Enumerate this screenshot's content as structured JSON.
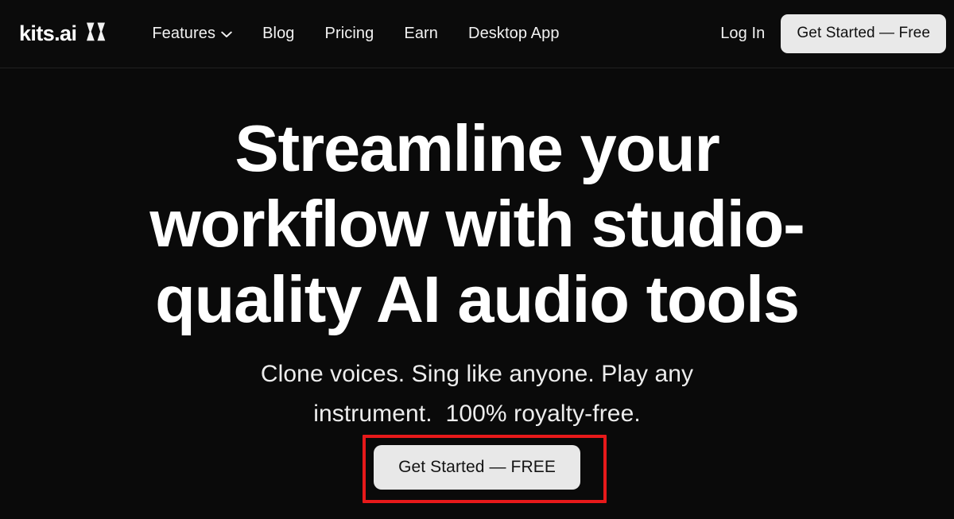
{
  "site": {
    "brand_name": "kits.ai",
    "brand_mark_icon": "double-chevron-k-mark",
    "background_color": "#0a0a0a"
  },
  "header": {
    "nav_items": [
      {
        "label": "Features",
        "has_dropdown": true,
        "dropdown_icon": "chevron-down-icon"
      },
      {
        "label": "Blog",
        "has_dropdown": false
      },
      {
        "label": "Pricing",
        "has_dropdown": false
      },
      {
        "label": "Earn",
        "has_dropdown": false
      },
      {
        "label": "Desktop App",
        "has_dropdown": false
      }
    ],
    "login_label": "Log In",
    "cta_label": "Get Started — Free",
    "cta_background_color": "#e9e9e9",
    "cta_text_color": "#101010"
  },
  "hero": {
    "headline_lines": [
      "Streamline your",
      "workflow with studio-",
      "quality AI audio tools"
    ],
    "subhead_lines": [
      "Clone voices. Sing like anyone. Play any",
      "instrument.  100% royalty-free."
    ],
    "cta_label": "Get Started — FREE",
    "cta_background_color": "#e8e8e8",
    "cta_text_color": "#141414"
  },
  "annotation": {
    "type": "highlight-rectangle",
    "target": "hero-cta-button",
    "color": "#e7191a",
    "border_width_px": 4
  }
}
